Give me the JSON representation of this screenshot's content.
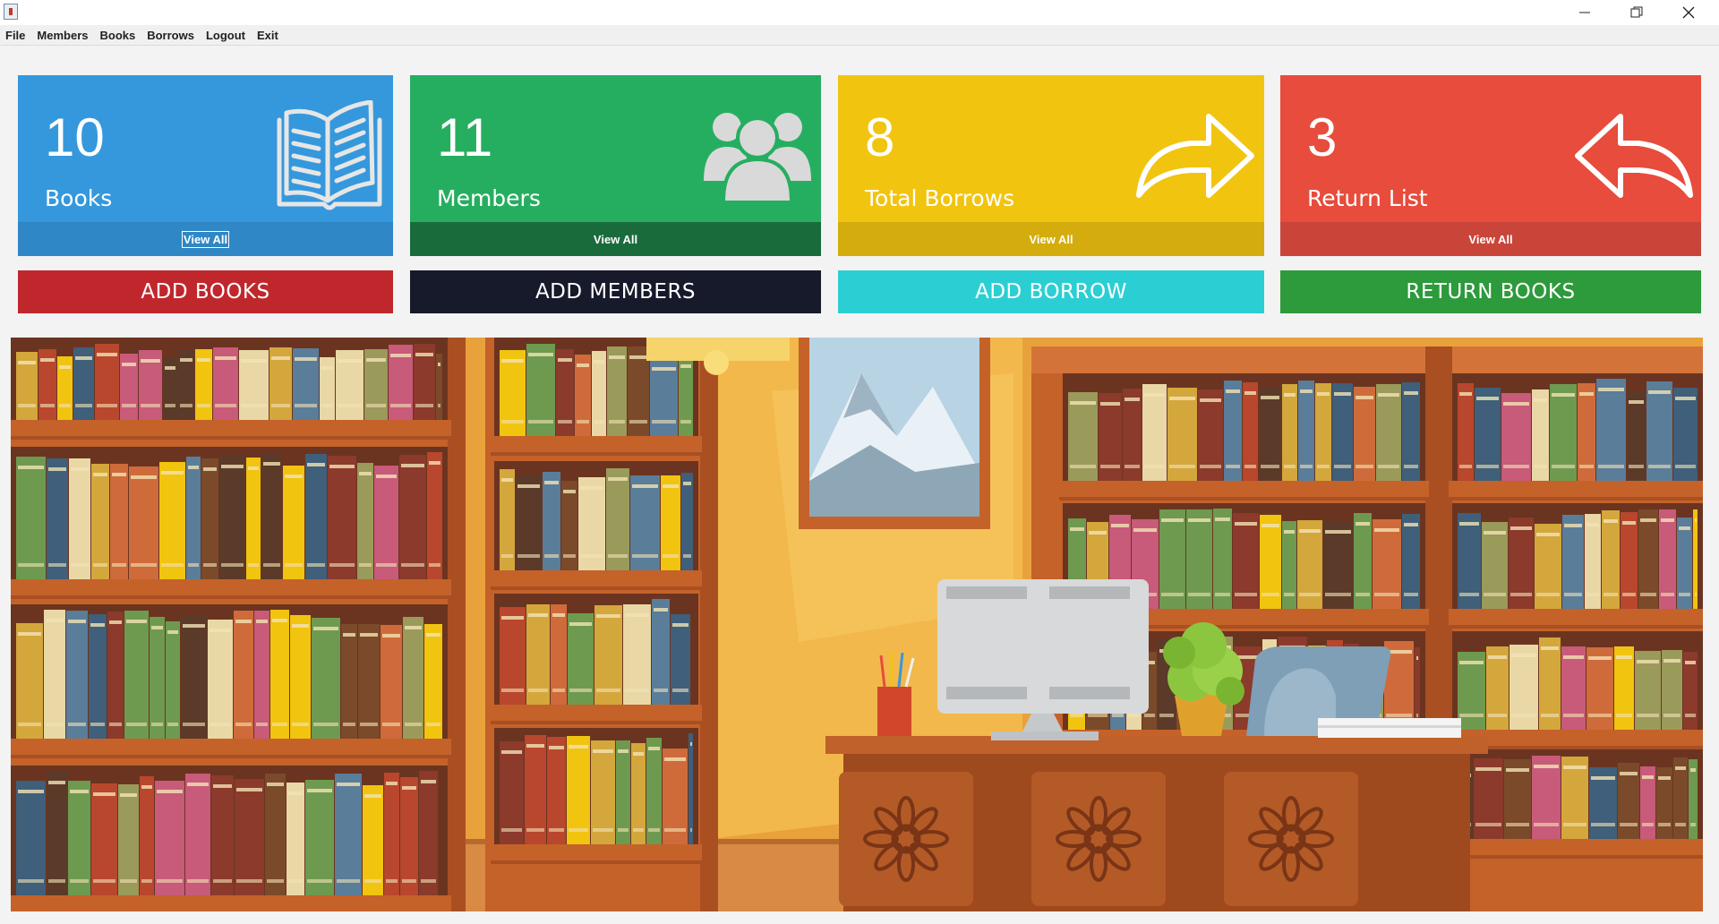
{
  "window": {
    "controls": {
      "minimize": "–",
      "restore": "❐",
      "close": "✕"
    }
  },
  "menu": [
    "File",
    "Members",
    "Books",
    "Borrows",
    "Logout",
    "Exit"
  ],
  "cards": [
    {
      "value": "10",
      "label": "Books",
      "link": "View All",
      "color": "#3598dc",
      "footer_color": "#2f87c5",
      "icon": "open-book-icon"
    },
    {
      "value": "11",
      "label": "Members",
      "link": "View All",
      "color": "#26ae60",
      "footer_color": "#1a6b3c",
      "icon": "users-group-icon"
    },
    {
      "value": "8",
      "label": "Total Borrows",
      "link": "View All",
      "color": "#f1c40f",
      "footer_color": "#d4ac0d",
      "icon": "arrow-forward-icon"
    },
    {
      "value": "3",
      "label": "Return List",
      "link": "View All",
      "color": "#e74c3c",
      "footer_color": "#c9453a",
      "icon": "arrow-return-icon"
    }
  ],
  "actions": [
    {
      "label": "ADD BOOKS",
      "color": "#c0272d"
    },
    {
      "label": "ADD MEMBERS",
      "color": "#161a2b"
    },
    {
      "label": "ADD BORROW",
      "color": "#2bcfd3"
    },
    {
      "label": "RETURN BOOKS",
      "color": "#2d9a3c"
    }
  ],
  "scene": {
    "description_icon": "library-illustration"
  }
}
